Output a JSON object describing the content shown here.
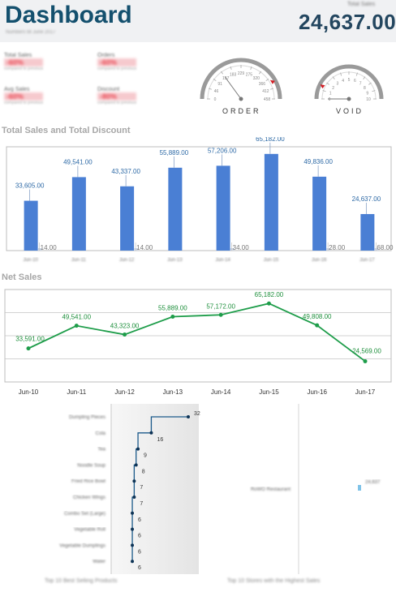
{
  "header": {
    "title": "Dashboard",
    "subtitle": "Numbers till June 2017",
    "total_sales_label": "Total Sales",
    "total_sales_value": "24,637.00"
  },
  "kpis": [
    {
      "name": "Total Sales",
      "value": "-60%",
      "sub": "compared to previous"
    },
    {
      "name": "Orders",
      "value": "-60%",
      "sub": "compared to previous"
    },
    {
      "name": "Avg Sales",
      "value": "-60%",
      "sub": "compared to previous"
    },
    {
      "name": "Discount",
      "value": "-80%",
      "sub": "compared to previous"
    }
  ],
  "gauges": [
    {
      "label": "ORDER",
      "ticks": [
        "0",
        "46",
        "91",
        "137",
        "183",
        "229",
        "275",
        "320",
        "366",
        "412",
        "458"
      ],
      "value_fraction": 0.3,
      "needle_color": "#d41c23"
    },
    {
      "label": "VOID",
      "ticks": [
        "0",
        "1",
        "2",
        "3",
        "4",
        "5",
        "6",
        "7",
        "8",
        "9",
        "10"
      ],
      "value_fraction": 0.0,
      "needle_color": "#d41c23"
    }
  ],
  "sales_chart": {
    "title": "Total Sales and Total Discount",
    "categories": [
      "Jun-10",
      "Jun-11",
      "Jun-12",
      "Jun-13",
      "Jun-14",
      "Jun-15",
      "Jun-16",
      "Jun-17"
    ],
    "sales_labels": [
      "33,605.00",
      "49,541.00",
      "43,337.00",
      "55,889.00",
      "57,206.00",
      "65,182.00",
      "49,836.00",
      "24,637.00"
    ],
    "discount_labels": [
      "14.00",
      "",
      "14.00",
      "",
      "34.00",
      "",
      "28.00",
      "68.00"
    ]
  },
  "net_chart": {
    "title": "Net Sales",
    "value_labels": [
      "33,591.00",
      "49,541.00",
      "43,323.00",
      "55,889.00",
      "57,172.00",
      "65,182.00",
      "49,808.00",
      "24,569.00"
    ],
    "x_labels": [
      "Jun-10",
      "Jun-11",
      "Jun-12",
      "Jun-13",
      "Jun-14",
      "Jun-15",
      "Jun-16",
      "Jun-17"
    ]
  },
  "top_products": {
    "names": [
      "Dumpling Pieces",
      "Cola",
      "Tea",
      "Noodle Soup",
      "Fried Rice Bowl",
      "Chicken Wings",
      "Combo Set (Large)",
      "Vegetable Roll",
      "Vegetable Dumplings",
      "Water"
    ],
    "values": [
      "32",
      "16",
      "9",
      "8",
      "7",
      "7",
      "6",
      "6",
      "6",
      "6"
    ],
    "footer": "Top 10 Best Selling Products"
  },
  "top_stores": {
    "names": [
      "RoWO Restaurant"
    ],
    "values": [
      "24,637"
    ],
    "footer": "Top 10 Stores with the Highest Sales"
  },
  "chart_data": [
    {
      "type": "bar",
      "title": "Total Sales and Total Discount",
      "categories": [
        "Jun-10",
        "Jun-11",
        "Jun-12",
        "Jun-13",
        "Jun-14",
        "Jun-15",
        "Jun-16",
        "Jun-17"
      ],
      "series": [
        {
          "name": "Total Sales",
          "values": [
            33605,
            49541,
            43337,
            55889,
            57206,
            65182,
            49836,
            24637
          ]
        },
        {
          "name": "Total Discount",
          "values": [
            14,
            0,
            14,
            0,
            34,
            0,
            28,
            68
          ]
        }
      ],
      "ylim": [
        0,
        70000
      ],
      "colors": {
        "sales": "#4a7fd4",
        "discount": "#cfd8e6"
      }
    },
    {
      "type": "line",
      "title": "Net Sales",
      "x": [
        "Jun-10",
        "Jun-11",
        "Jun-12",
        "Jun-13",
        "Jun-14",
        "Jun-15",
        "Jun-16",
        "Jun-17"
      ],
      "series": [
        {
          "values": [
            33591,
            49541,
            43323,
            55889,
            57172,
            65182,
            49808,
            24569
          ]
        }
      ],
      "ylim": [
        10000,
        75000
      ],
      "color": "#1e9d4a"
    },
    {
      "type": "line",
      "title": "Top 10 Best Selling Products",
      "categories": [
        "Dumpling Pieces",
        "Cola",
        "Tea",
        "Noodle Soup",
        "Fried Rice Bowl",
        "Chicken Wings",
        "Combo Set (Large)",
        "Vegetable Roll",
        "Vegetable Dumplings",
        "Water"
      ],
      "values": [
        32,
        16,
        9,
        8,
        7,
        7,
        6,
        6,
        6,
        6
      ],
      "xlim": [
        0,
        35
      ],
      "color": "#1b5a8a"
    }
  ]
}
